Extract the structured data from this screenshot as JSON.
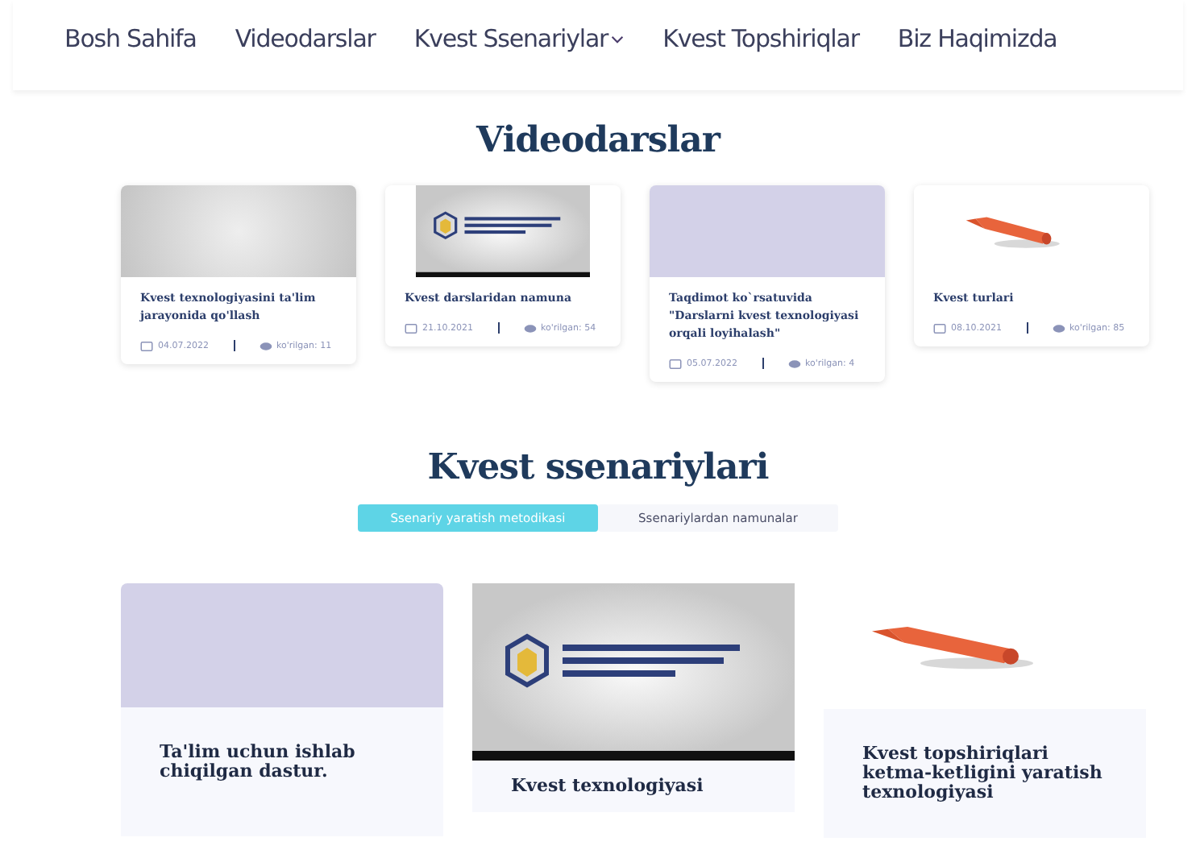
{
  "nav": {
    "items": [
      {
        "label": "Bosh Sahifa",
        "dropdown": false
      },
      {
        "label": "Videodarslar",
        "dropdown": false
      },
      {
        "label": "Kvest Ssenariylar",
        "dropdown": true
      },
      {
        "label": "Kvest Topshiriqlar",
        "dropdown": false
      },
      {
        "label": "Biz Haqimizda",
        "dropdown": false
      }
    ]
  },
  "videos": {
    "title": "Videodarslar",
    "cards": [
      {
        "title": "Kvest texnologiyasini ta'lim jarayonida qo'llash",
        "date": "04.07.2022",
        "views": "ko'rilgan: 11"
      },
      {
        "title": "Kvest darslaridan namuna",
        "date": "21.10.2021",
        "views": "ko'rilgan: 54"
      },
      {
        "title": "Taqdimot ko`rsatuvida \"Darslarni kvest texnologiyasi orqali loyihalash\"",
        "date": "05.07.2022",
        "views": "ko'rilgan: 4"
      },
      {
        "title": "Kvest turlari",
        "date": "08.10.2021",
        "views": "ko'rilgan: 85"
      }
    ]
  },
  "scenarios": {
    "title": "Kvest ssenariylari",
    "tabs": [
      {
        "label": "Ssenariy yaratish metodikasi",
        "selected": true
      },
      {
        "label": "Ssenariylardan namunalar",
        "selected": false
      }
    ],
    "cards": [
      {
        "title": "Ta'lim uchun ishlab chiqilgan dastur."
      },
      {
        "title": "Kvest texnologiyasi"
      },
      {
        "title": "Kvest topshiriqlari ketma-ketligini yaratish texnologiyasi"
      }
    ]
  }
}
